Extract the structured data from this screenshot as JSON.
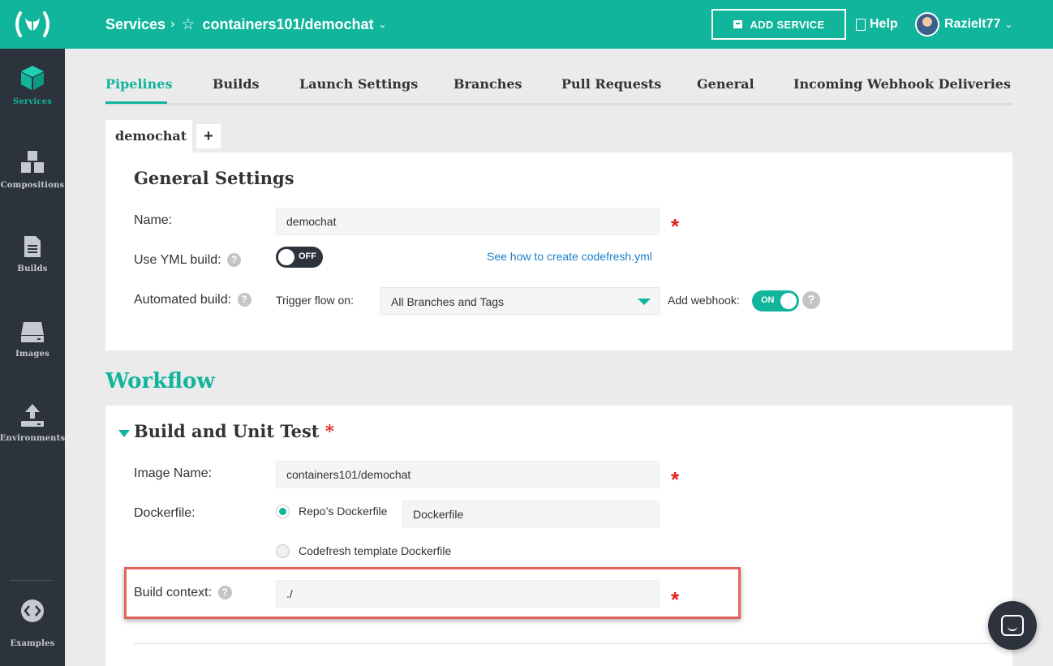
{
  "sidebar": {
    "items": [
      {
        "label": "Services",
        "icon": "cube-icon",
        "active": true
      },
      {
        "label": "Compositions",
        "icon": "cubes-icon"
      },
      {
        "label": "Builds",
        "icon": "document-icon"
      },
      {
        "label": "Images",
        "icon": "drive-icon"
      },
      {
        "label": "Environments",
        "icon": "upload-icon"
      },
      {
        "label": "Examples",
        "icon": "code-icon"
      }
    ]
  },
  "topbar": {
    "breadcrumb_root": "Services",
    "breadcrumb_sep": "›",
    "star": "☆",
    "repo": "containers101/demochat",
    "add_service": "ADD SERVICE",
    "help": "Help",
    "username": "Razielt77",
    "accent_color": "#10b59b"
  },
  "tabs": [
    "Pipelines",
    "Builds",
    "Launch Settings",
    "Branches",
    "Pull Requests",
    "General",
    "Incoming Webhook Deliveries"
  ],
  "pipeline_tab": {
    "name": "demochat",
    "add": "+"
  },
  "general": {
    "title": "General Settings",
    "name_label": "Name:",
    "name_value": "demochat",
    "yml_label": "Use YML build:",
    "yml_toggle": "OFF",
    "yml_link": "See how to create codefresh.yml",
    "auto_label": "Automated build:",
    "trigger_label": "Trigger flow on:",
    "trigger_value": "All Branches and Tags",
    "webhook_label": "Add webhook:",
    "webhook_toggle": "ON"
  },
  "workflow": {
    "title": "Workflow",
    "section_title": "Build and Unit Test",
    "image_label": "Image Name:",
    "image_value": "containers101/demochat",
    "dockerfile_label": "Dockerfile:",
    "repo_dockerfile": "Repo’s Dockerfile",
    "dockerfile_value": "Dockerfile",
    "template_dockerfile": "Codefresh template Dockerfile",
    "context_label": "Build context:",
    "context_value": "./"
  },
  "required_mark": "*",
  "help_mark": "?"
}
